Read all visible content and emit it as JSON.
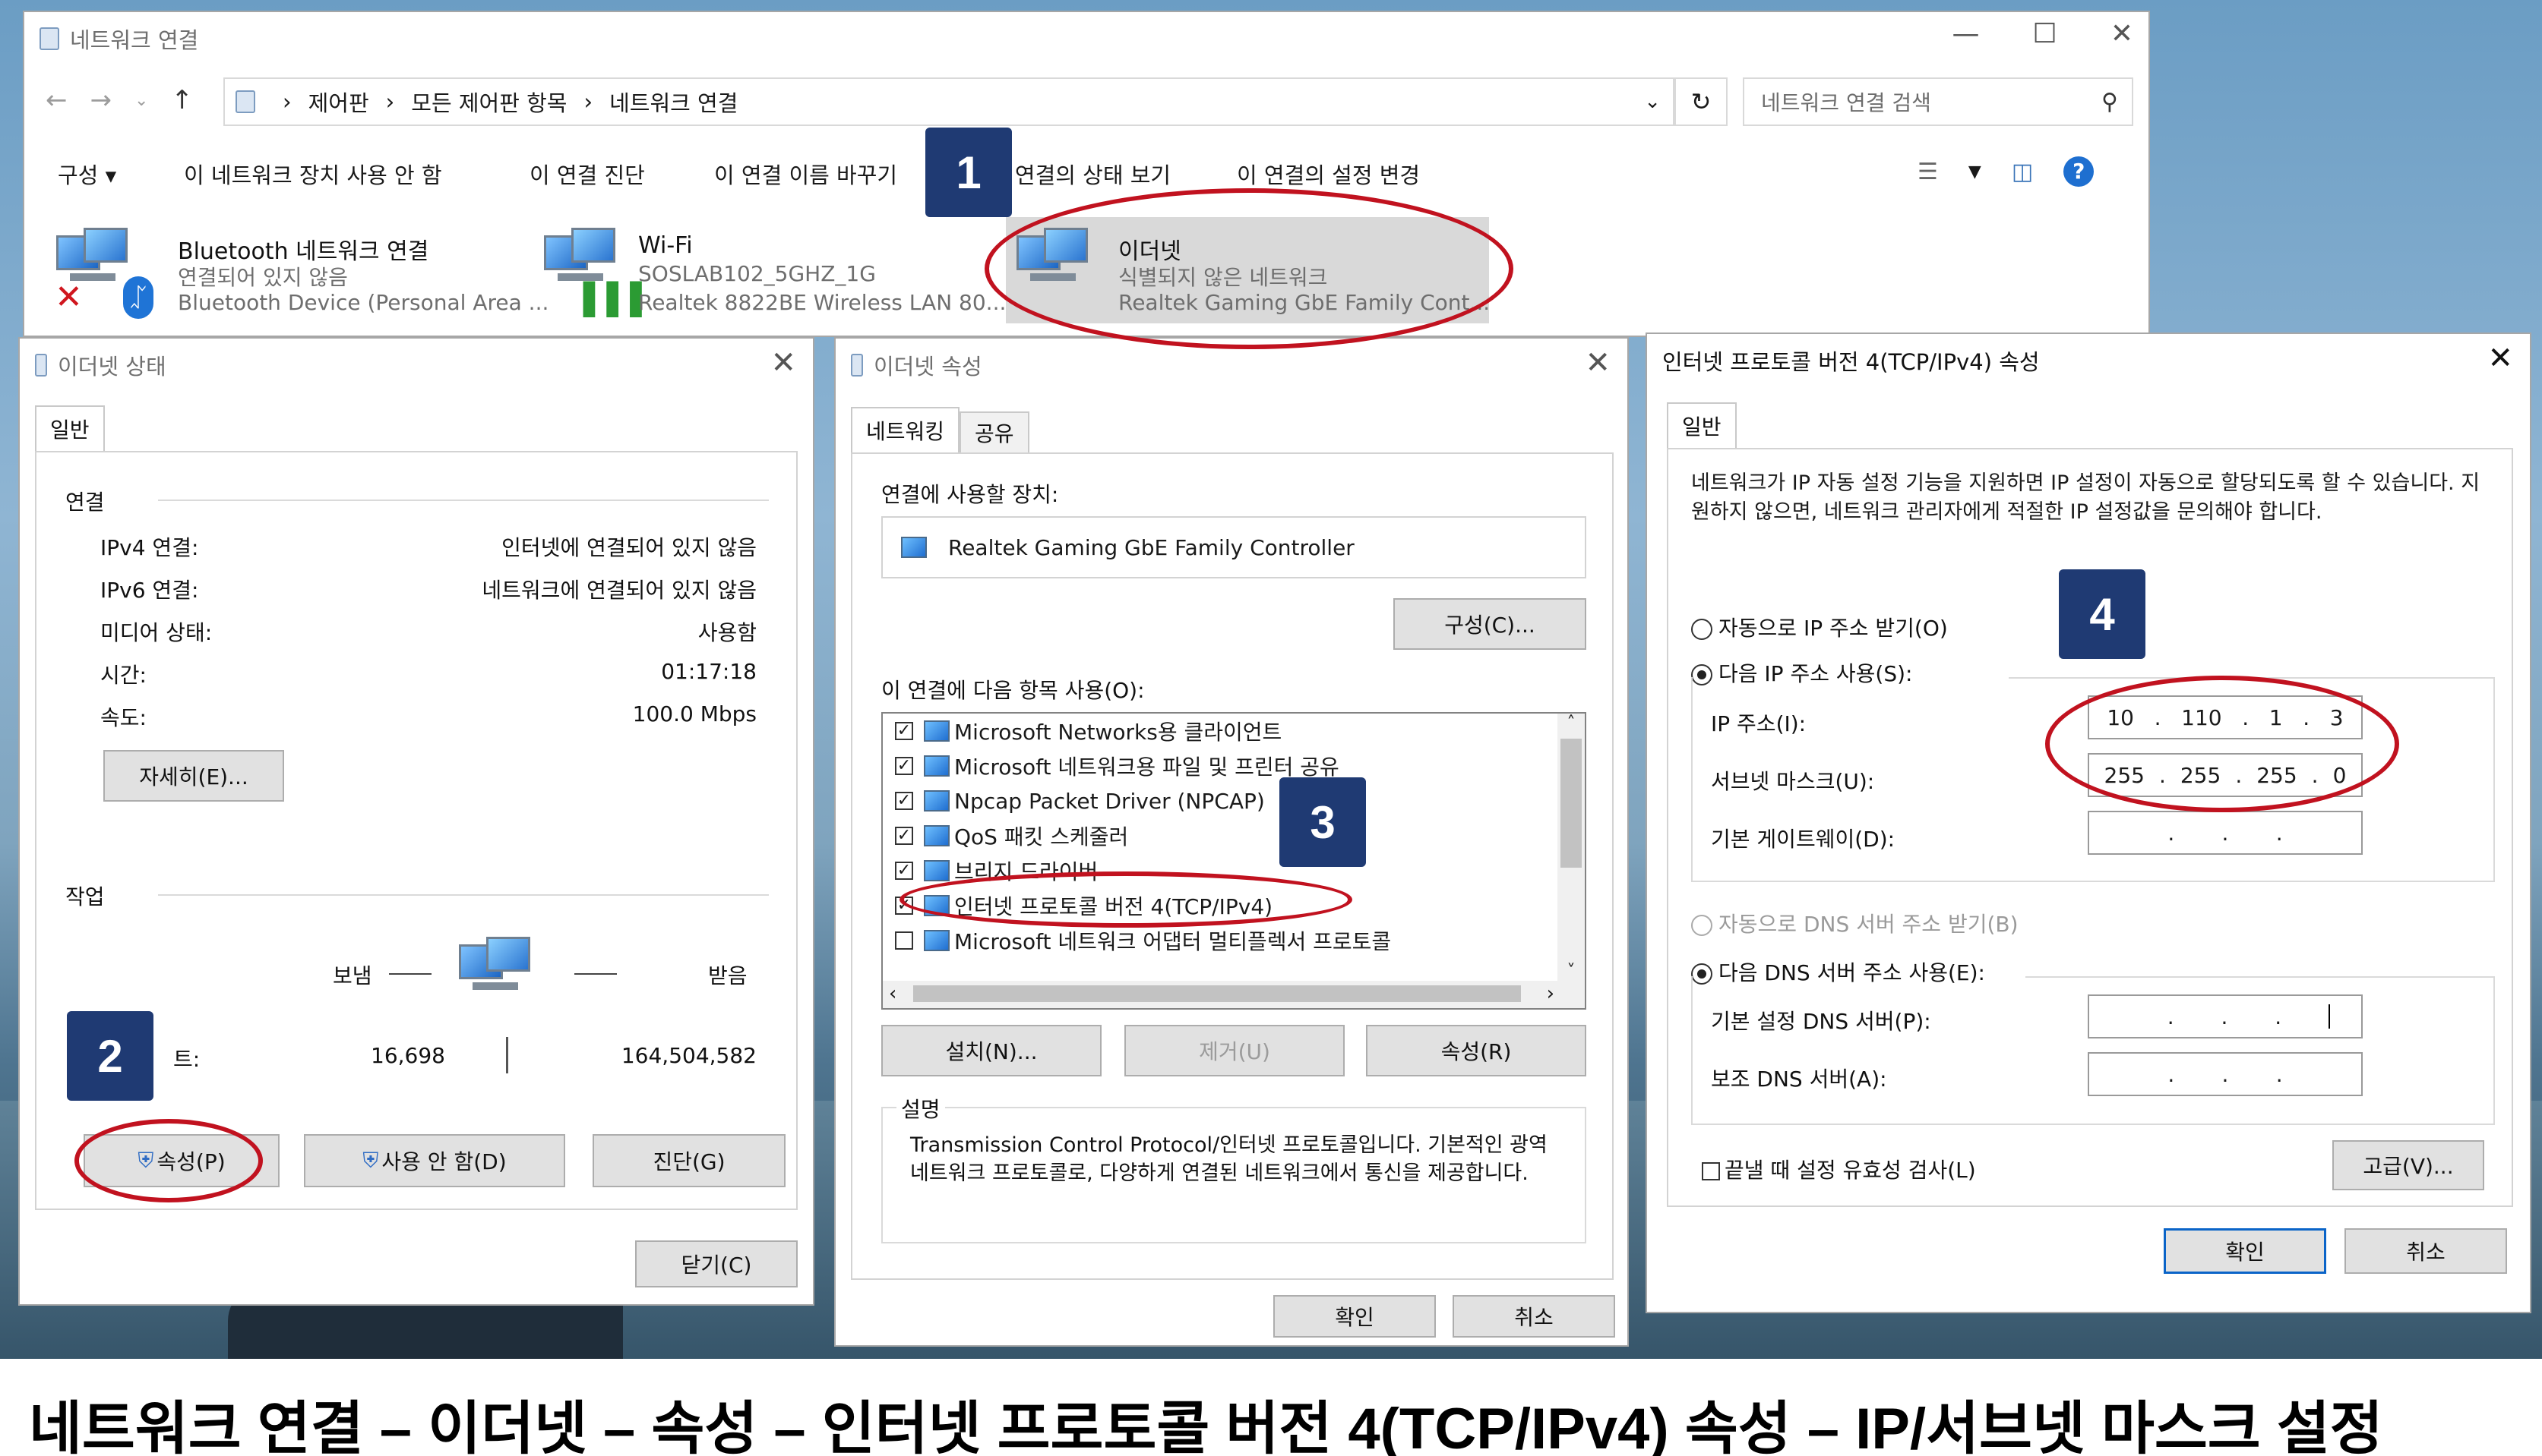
{
  "explorer": {
    "title": "네트워크 연결",
    "breadcrumb": [
      "제어판",
      "모든 제어판 항목",
      "네트워크 연결"
    ],
    "search_placeholder": "네트워크 연결 검색",
    "toolbar": [
      "구성 ▾",
      "이 네트워크 장치 사용 안 함",
      "이 연결 진단",
      "이 연결 이름 바꾸기",
      "이 연결의 상태 보기",
      "이 연결의 설정 변경"
    ],
    "adapters": [
      {
        "name": "Bluetooth 네트워크 연결",
        "status": "연결되어 있지 않음",
        "device": "Bluetooth Device (Personal Area ..."
      },
      {
        "name": "Wi-Fi",
        "status": "SOSLAB102_5GHZ_1G",
        "device": "Realtek 8822BE Wireless LAN 80..."
      },
      {
        "name": "이더넷",
        "status": "식별되지 않은 네트워크",
        "device": "Realtek Gaming GbE Family Cont..."
      }
    ]
  },
  "status_dialog": {
    "title": "이더넷 상태",
    "tab": "일반",
    "section_connection": "연결",
    "rows": [
      {
        "label": "IPv4 연결:",
        "value": "인터넷에 연결되어 있지 않음"
      },
      {
        "label": "IPv6 연결:",
        "value": "네트워크에 연결되어 있지 않음"
      },
      {
        "label": "미디어 상태:",
        "value": "사용함"
      },
      {
        "label": "시간:",
        "value": "01:17:18"
      },
      {
        "label": "속도:",
        "value": "100.0 Mbps"
      }
    ],
    "details_button": "자세히(E)...",
    "section_activity": "작업",
    "sent_label": "보냄",
    "received_label": "받음",
    "bytes_label_tail": "트:",
    "bytes_sent": "16,698",
    "bytes_received": "164,504,582",
    "properties_button": "속성(P)",
    "disable_button": "사용 안 함(D)",
    "diagnose_button": "진단(G)",
    "close_button": "닫기(C)"
  },
  "props_dialog": {
    "title": "이더넷 속성",
    "tabs": [
      "네트워킹",
      "공유"
    ],
    "connect_using_label": "연결에 사용할 장치:",
    "device_name": "Realtek Gaming GbE Family Controller",
    "configure_button": "구성(C)...",
    "items_label": "이 연결에 다음 항목 사용(O):",
    "items": [
      {
        "label": "Microsoft Networks용 클라이언트",
        "checked": true
      },
      {
        "label": "Microsoft 네트워크용 파일 및 프린터 공유",
        "checked": true
      },
      {
        "label": "Npcap Packet Driver (NPCAP)",
        "checked": true
      },
      {
        "label": "QoS 패킷 스케줄러",
        "checked": true
      },
      {
        "label": "브리지 드라이버",
        "checked": true
      },
      {
        "label": "인터넷 프로토콜 버전 4(TCP/IPv4)",
        "checked": true
      },
      {
        "label": "Microsoft 네트워크 어댑터 멀티플렉서 프로토콜",
        "checked": false
      }
    ],
    "install_button": "설치(N)...",
    "uninstall_button": "제거(U)",
    "properties_button": "속성(R)",
    "description_label": "설명",
    "description": "Transmission Control Protocol/인터넷 프로토콜입니다. 기본적인 광역 네트워크 프로토콜로, 다양하게 연결된 네트워크에서 통신을 제공합니다.",
    "ok_button": "확인",
    "cancel_button": "취소"
  },
  "ipv4_dialog": {
    "title": "인터넷 프로토콜 버전 4(TCP/IPv4) 속성",
    "tab": "일반",
    "intro": "네트워크가 IP 자동 설정 기능을 지원하면 IP 설정이 자동으로 할당되도록 할 수 있습니다. 지원하지 않으면, 네트워크 관리자에게 적절한 IP 설정값을 문의해야 합니다.",
    "auto_ip": "자동으로 IP 주소 받기(O)",
    "manual_ip": "다음 IP 주소 사용(S):",
    "ip_label": "IP 주소(I):",
    "ip_value": [
      "10",
      "110",
      "1",
      "3"
    ],
    "subnet_label": "서브넷 마스크(U):",
    "subnet_value": [
      "255",
      "255",
      "255",
      "0"
    ],
    "gateway_label": "기본 게이트웨이(D):",
    "auto_dns": "자동으로 DNS 서버 주소 받기(B)",
    "manual_dns": "다음 DNS 서버 주소 사용(E):",
    "dns1_label": "기본 설정 DNS 서버(P):",
    "dns2_label": "보조 DNS 서버(A):",
    "validate_label": "끝낼 때 설정 유효성 검사(L)",
    "advanced_button": "고급(V)...",
    "ok_button": "확인",
    "cancel_button": "취소"
  },
  "steps": [
    "1",
    "2",
    "3",
    "4"
  ],
  "caption": "네트워크 연결 – 이더넷 – 속성 – 인터넷 프로토콜 버전 4(TCP/IPv4) 속성 – IP/서브넷 마스크 설정",
  "colors": {
    "highlight": "#c1121f",
    "badge": "#1f3a73",
    "accent": "#0a64c8"
  }
}
